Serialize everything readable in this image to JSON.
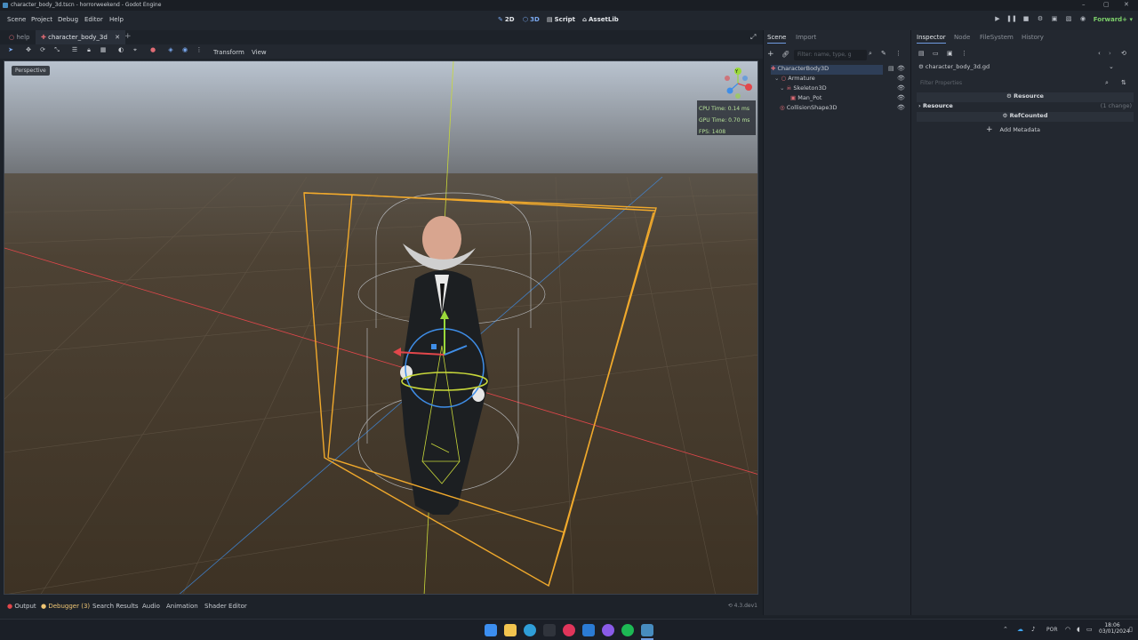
{
  "window": {
    "title": "character_body_3d.tscn - horrorweekend - Godot Engine",
    "controls": [
      "–",
      "▢",
      "✕"
    ]
  },
  "menu": [
    "Scene",
    "Project",
    "Debug",
    "Editor",
    "Help"
  ],
  "workspaces": [
    {
      "icon": "2d-icon",
      "label": "2D"
    },
    {
      "icon": "3d-icon",
      "label": "3D"
    },
    {
      "icon": "script-icon",
      "label": "Script"
    },
    {
      "icon": "assetlib-icon",
      "label": "AssetLib"
    }
  ],
  "renderer": "Forward+",
  "scene_tabs": [
    {
      "label": "help",
      "active": false
    },
    {
      "label": "character_body_3d",
      "active": true
    }
  ],
  "viewport": {
    "toolbar_menus": [
      "Transform",
      "View"
    ],
    "perspective_label": "Perspective",
    "stats": {
      "cpu": "CPU Time: 0.14 ms",
      "gpu": "GPU Time: 0.70 ms",
      "fps": "FPS: 1408"
    },
    "gizmo_axis_label": "Y"
  },
  "bottom_panel": {
    "tabs": [
      "Output",
      "Debugger (3)",
      "Search Results",
      "Audio",
      "Animation",
      "Shader Editor"
    ],
    "version": "4.3.dev1"
  },
  "scene_dock": {
    "tabs": [
      "Scene",
      "Import"
    ],
    "filter_placeholder": "Filter: name, type, g",
    "tree": [
      {
        "label": "CharacterBody3D",
        "depth": 0,
        "selected": true,
        "color": "#e06c75"
      },
      {
        "label": "Armature",
        "depth": 1,
        "selected": false,
        "color": "#e06c75"
      },
      {
        "label": "Skeleton3D",
        "depth": 2,
        "selected": false,
        "color": "#e06c75"
      },
      {
        "label": "Man_Pot",
        "depth": 3,
        "selected": false,
        "color": "#e06c75"
      },
      {
        "label": "CollisionShape3D",
        "depth": 1,
        "selected": false,
        "color": "#e06c75"
      }
    ]
  },
  "inspector": {
    "tabs": [
      "Inspector",
      "Node",
      "FileSystem",
      "History"
    ],
    "resource_name": "character_body_3d.gd",
    "filter_placeholder": "Filter Properties",
    "sections": {
      "resource_header": "Resource",
      "resource_row": "Resource",
      "resource_change": "(1 change)",
      "refcounted_header": "RefCounted",
      "add_metadata": "Add Metadata"
    }
  },
  "taskbar": {
    "language": "POR",
    "time": "18:06",
    "date": "03/01/2024"
  },
  "colors": {
    "accent": "#6f9be0",
    "selection_box": "#f0a92c",
    "x_axis": "#e2474b",
    "y_axis": "#9ad93a",
    "z_axis": "#3f8ee8"
  }
}
